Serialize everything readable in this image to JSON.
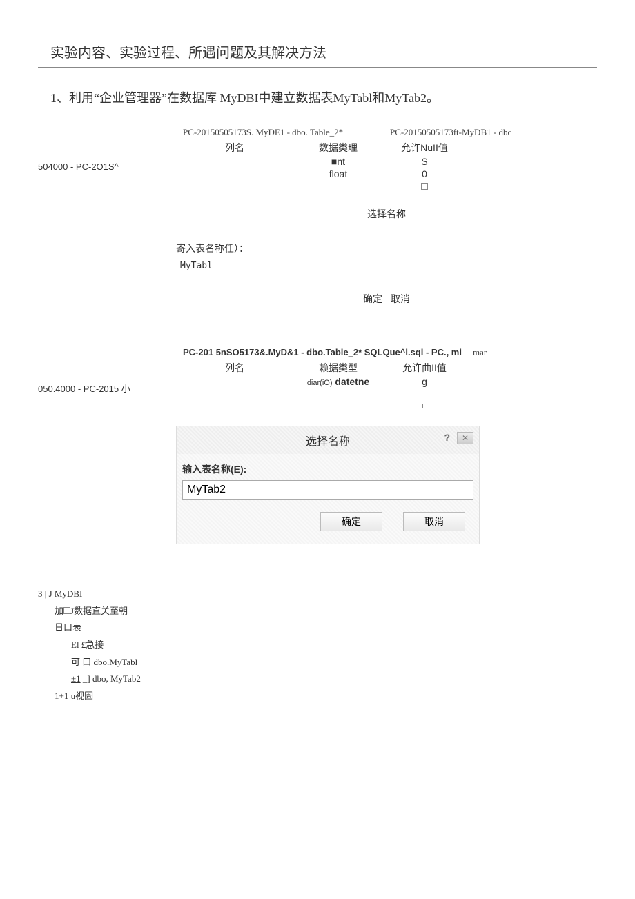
{
  "heading": "实验内容、实验过程、所遇问题及其解决方法",
  "step1": "1、利用“企业管理器”在数据库 MyDBI中建立数据表MyTabl和MyTab2。",
  "sec1": {
    "leftlabel": "504000 - PC-2O1S^",
    "path1": "PC-20150505173S. MyDE1 - dbo. Table_2*",
    "path2": "PC-20150505173ft-MyDB1 - dbc",
    "hdr_col": "列名",
    "hdr_type": "数据类理",
    "hdr_null": "允许NuII值",
    "r1_type": "■nt",
    "r1_null": "S",
    "r2_type": "float",
    "r2_null": "0",
    "dialog_title": "选择名称",
    "dialog_label": "寄入表名称任）：",
    "dialog_value": "MyTabl",
    "ok": "确定",
    "cancel": "取消"
  },
  "sec2": {
    "leftlabel": "050.4000 - PC-2015 小",
    "path1": "PC-201 5nSO5173&.MyD&1 - dbo.Table_2* SQLQue^l.sql - PC., mi",
    "path2": "mar",
    "hdr_col": "列名",
    "hdr_type": "赖据类型",
    "hdr_null": "允许曲II值",
    "r1_type1": "diar(iO)",
    "r1_type2": "datetne",
    "r1_null": "g",
    "dialog_title": "选择名称",
    "dialog_label": "输入表名称(E):",
    "dialog_value": "MyTab2",
    "ok": "确定",
    "cancel": "取消"
  },
  "tree": {
    "n1": "3 | J MyDBI",
    "n2a": "加",
    "n2b": "J数据直关至朝",
    "n3": "日口表",
    "n4": "El £急接",
    "n5": "可 口 dbo.MyTabl",
    "n6a": "±1",
    "n6b": " _] dbo, MyTab2",
    "n7": "1+1 u视圄"
  }
}
